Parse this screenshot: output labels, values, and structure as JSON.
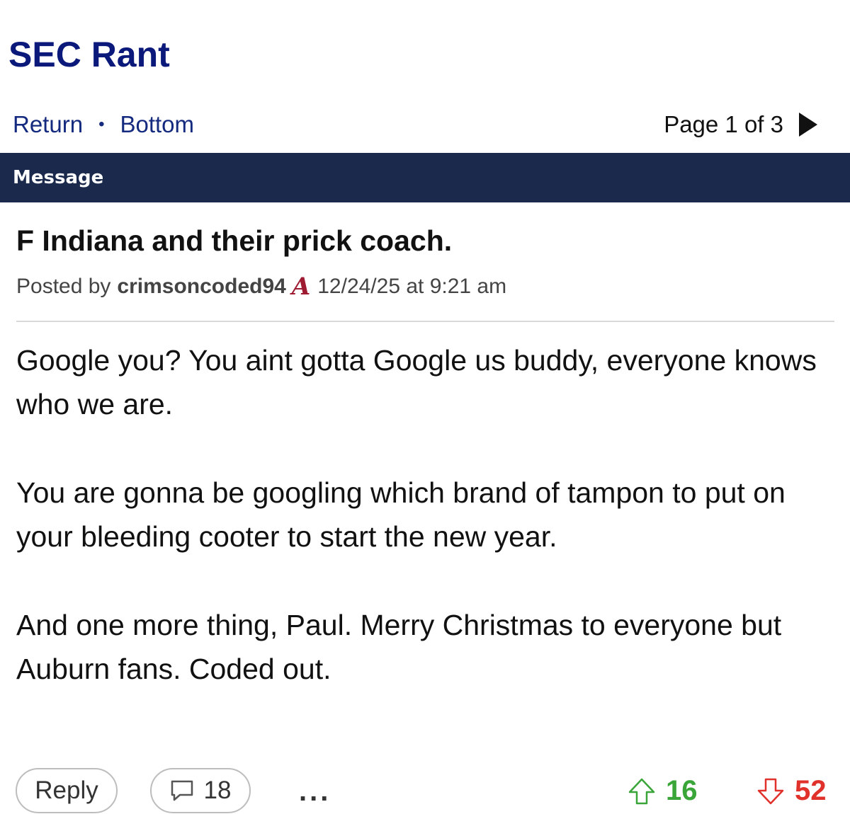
{
  "board": {
    "title": "SEC Rant"
  },
  "nav": {
    "return_label": "Return",
    "separator": "•",
    "bottom_label": "Bottom",
    "page_info": "Page 1 of 3"
  },
  "table_header": {
    "label": "Message"
  },
  "post": {
    "title": "F Indiana and their prick coach.",
    "posted_by_prefix": "Posted by",
    "author": "crimsoncoded94",
    "team_logo": "A",
    "timestamp": "12/24/25 at 9:21 am",
    "paragraphs": [
      "Google you? You aint gotta Google us buddy, everyone knows who we are.",
      "You are gonna be googling which brand of tampon to put on your bleeding cooter to start the new year.",
      "And one more thing, Paul. Merry Christmas to everyone but Auburn fans. Coded out."
    ]
  },
  "actions": {
    "reply_label": "Reply",
    "comment_count": "18",
    "more_label": "...",
    "upvotes": "16",
    "downvotes": "52"
  },
  "colors": {
    "title": "#0b1a7a",
    "header_bar": "#1b2a4c",
    "upvote": "#3aa63a",
    "downvote": "#e0312b",
    "team_logo": "#9e1b32"
  },
  "icons": [
    "next-page-arrow-icon",
    "comment-bubble-icon",
    "upvote-arrow-icon",
    "downvote-arrow-icon"
  ]
}
